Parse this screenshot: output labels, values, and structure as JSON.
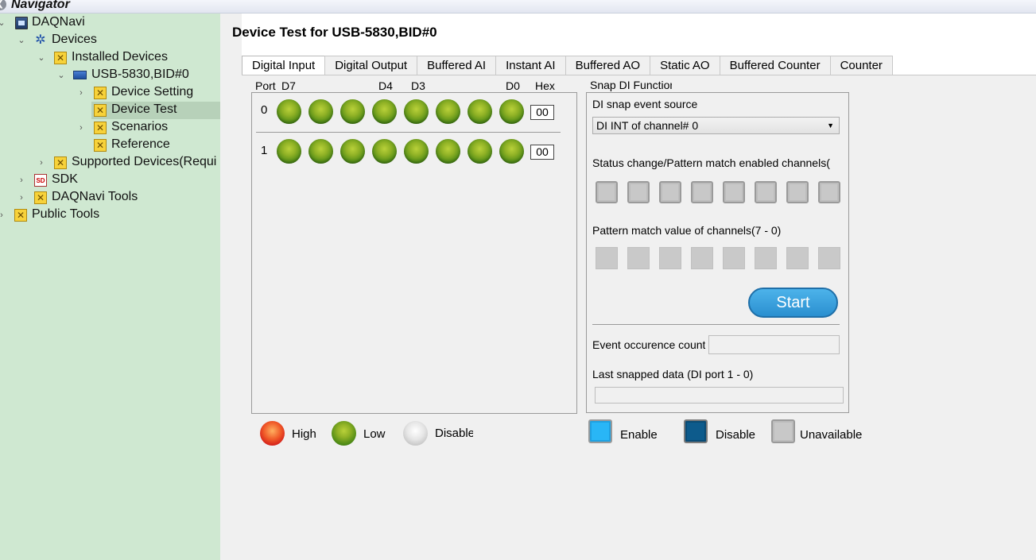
{
  "navigator": {
    "title": "Navigator",
    "tree": [
      {
        "label": "DAQNavi",
        "icon": "computer-icon"
      },
      {
        "label": "Devices",
        "icon": "gear-icon"
      },
      {
        "label": "Installed Devices",
        "icon": "tool-icon"
      },
      {
        "label": "USB-5830,BID#0",
        "icon": "usb-device-icon"
      },
      {
        "label": "Device Setting",
        "icon": "tool-icon"
      },
      {
        "label": "Device Test",
        "icon": "tool-icon",
        "selected": true
      },
      {
        "label": "Scenarios",
        "icon": "tool-icon"
      },
      {
        "label": "Reference",
        "icon": "tool-icon"
      },
      {
        "label": "Supported Devices(Requi",
        "icon": "tool-icon"
      },
      {
        "label": "SDK",
        "icon": "sdk-icon"
      },
      {
        "label": "DAQNavi Tools",
        "icon": "tool-icon"
      },
      {
        "label": "Public Tools",
        "icon": "tool-icon"
      }
    ]
  },
  "main": {
    "title": "Device Test for USB-5830,BID#0",
    "tabs": [
      "Digital Input",
      "Digital Output",
      "Buffered AI",
      "Instant AI",
      "Buffered AO",
      "Static AO",
      "Buffered Counter",
      "Counter"
    ],
    "active_tab": "Digital Input"
  },
  "digital_input": {
    "headers": {
      "port": "Port",
      "d7": "D7",
      "d4": "D4",
      "d3": "D3",
      "d0": "D0",
      "hex": "Hex"
    },
    "ports": [
      {
        "port": "0",
        "hex": "00",
        "states": [
          "low",
          "low",
          "low",
          "low",
          "low",
          "low",
          "low",
          "low"
        ]
      },
      {
        "port": "1",
        "hex": "00",
        "states": [
          "low",
          "low",
          "low",
          "low",
          "low",
          "low",
          "low",
          "low"
        ]
      }
    ],
    "legend": {
      "high": "High",
      "low": "Low",
      "disabled": "Disabled"
    }
  },
  "snap": {
    "title": "Snap DI Function",
    "event_source_label": "DI snap event source",
    "event_source_value": "DI INT of channel# 0",
    "enabled_channels_label": "Status change/Pattern match enabled channels(",
    "pattern_value_label": "Pattern match value of channels(7 - 0)",
    "start_label": "Start",
    "event_count_label": "Event occurence count",
    "event_count_value": "",
    "last_snapped_label": "Last snapped data (DI port 1 - 0)",
    "last_snapped_value": "",
    "legend": {
      "enable": "Enable",
      "disable": "Disable",
      "unavailable": "Unavailable"
    }
  }
}
